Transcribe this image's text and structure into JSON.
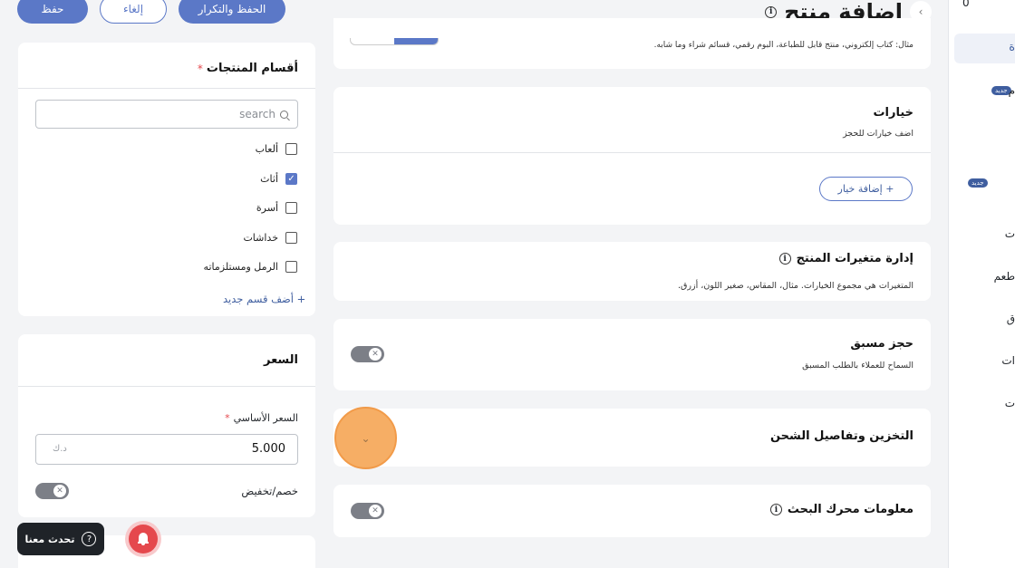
{
  "header": {
    "title": "إضافة منتج",
    "save_label": "حفظ",
    "cancel_label": "إلغاء",
    "save_repeat_label": "الحفظ والتكرار"
  },
  "type_hint": "مثال: كتاب إلكتروني، منتج قابل للطباعة، البوم رقمي، قسائم شراء وما شابه.",
  "options": {
    "title": "خيارات",
    "subtitle": "اضف خيارات للحجز",
    "add_label": "+ إضافة خيار"
  },
  "variants": {
    "title": "إدارة متغيرات المنتج",
    "subtitle": "المتغيرات هي مجموع الخيارات. مثال، المقاس، صغير اللون، أزرق."
  },
  "preorder": {
    "title": "حجز مسبق",
    "subtitle": "السماح للعملاء بالطلب المسبق",
    "enabled": false
  },
  "storage": {
    "title": "التخزين وتفاصيل الشحن"
  },
  "seo": {
    "title": "معلومات محرك البحث",
    "enabled": false
  },
  "categories": {
    "title": "أقسام المنتجات",
    "required_mark": "*",
    "search_placeholder": "search",
    "items": [
      {
        "label": "ألعاب",
        "checked": false
      },
      {
        "label": "أثاث",
        "checked": true
      },
      {
        "label": "أسرة",
        "checked": false
      },
      {
        "label": "خداشات",
        "checked": false
      },
      {
        "label": "الرمل ومستلزماته",
        "checked": false
      }
    ],
    "add_label": "+ أضف قسم جديد"
  },
  "price": {
    "title": "السعر",
    "base_label": "السعر الأساسي",
    "required_mark": "*",
    "value": "5.000",
    "currency": "د.ك",
    "discount_label": "خصم/تخفيض",
    "discount_enabled": false
  },
  "chat": {
    "label": "تحدث معنا"
  },
  "sidebar": {
    "counter": "0",
    "badge_new": "جديد",
    "frag1": "ة",
    "frag2": "م",
    "frag3": "ت",
    "frag4": "طعم",
    "frag5": "ق",
    "frag6": "ات",
    "frag7": "ت"
  },
  "colors": {
    "accent": "#5b78c7",
    "highlight": "#f5a14b",
    "notify": "#e5484d"
  }
}
